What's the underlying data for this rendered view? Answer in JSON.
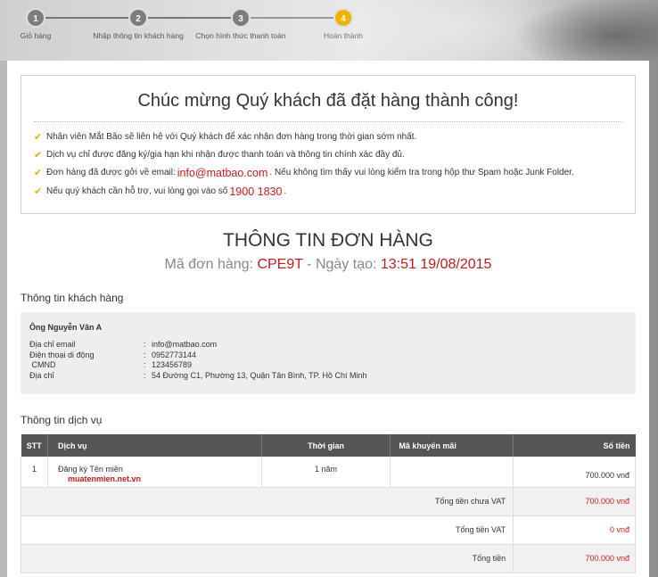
{
  "steps": [
    {
      "num": "1",
      "label": "Giỏ hàng"
    },
    {
      "num": "2",
      "label": "Nhập thông tin khách hàng"
    },
    {
      "num": "3",
      "label": "Chọn hình thức thanh toán"
    },
    {
      "num": "4",
      "label": "Hoàn thành"
    }
  ],
  "success": {
    "title": "Chúc mừng Quý khách đã đặt hàng thành công!",
    "line1": "Nhân viên Mắt Bão sẽ liên hệ với Quý khách để xác nhận đơn hàng trong thời gian sớm nhất.",
    "line2": "Dịch vụ chỉ được đăng ký/gia hạn khi nhận được thanh toán và thông tin chính xác đầy đủ.",
    "line3_pre": "Đơn hàng đã được gởi về email:",
    "line3_email": "info@matbao.com",
    "line3_post": ". Nếu không tìm thấy vui lòng kiểm tra trong hộp thư Spam hoặc Junk Folder.",
    "line4_pre": "Nếu quý khách cần hỗ trợ, vui lòng gọi vào số",
    "line4_phone": "1900 1830",
    "line4_post": "."
  },
  "order": {
    "title": "THÔNG TIN ĐƠN HÀNG",
    "code_label": "Mã đơn hàng:",
    "code": "CPE9T",
    "sep": "-",
    "date_label": "Ngày tạo:",
    "date": "13:51 19/08/2015"
  },
  "customer": {
    "section_title": "Thông tin khách hàng",
    "name": "Ông Nguyễn Văn A",
    "rows": [
      {
        "k": "Địa chỉ email",
        "v": "info@matbao.com"
      },
      {
        "k": "Điện thoại di động",
        "v": "0952773144"
      },
      {
        "k": " CMND",
        "v": "123456789"
      },
      {
        "k": "Địa chỉ",
        "v": "54 Đường C1, Phường 13, Quận Tân Bình, TP. Hồ Chí Minh"
      }
    ],
    "colon": ":"
  },
  "service": {
    "section_title": "Thông tin dịch vụ",
    "headers": {
      "stt": "STT",
      "dv": "Dịch vụ",
      "tg": "Thời gian",
      "km": "Mã khuyến mãi",
      "st": "Số tiền"
    },
    "rows": [
      {
        "stt": "1",
        "dv": "Đăng ký Tên miền",
        "domain": "muatenmien.net.vn",
        "tg": "1 năm",
        "km": "",
        "st": "700.000 vnđ"
      }
    ],
    "subtotal_label": "Tổng tiền chưa VAT",
    "subtotal": "700.000 vnđ",
    "vat_label": "Tổng tiền VAT",
    "vat": "0 vnđ",
    "total_label": "Tổng tiền",
    "total": "700.000 vnđ"
  },
  "colors": {
    "accent": "#f0b400",
    "red": "#c71a1a",
    "header": "#555555"
  }
}
